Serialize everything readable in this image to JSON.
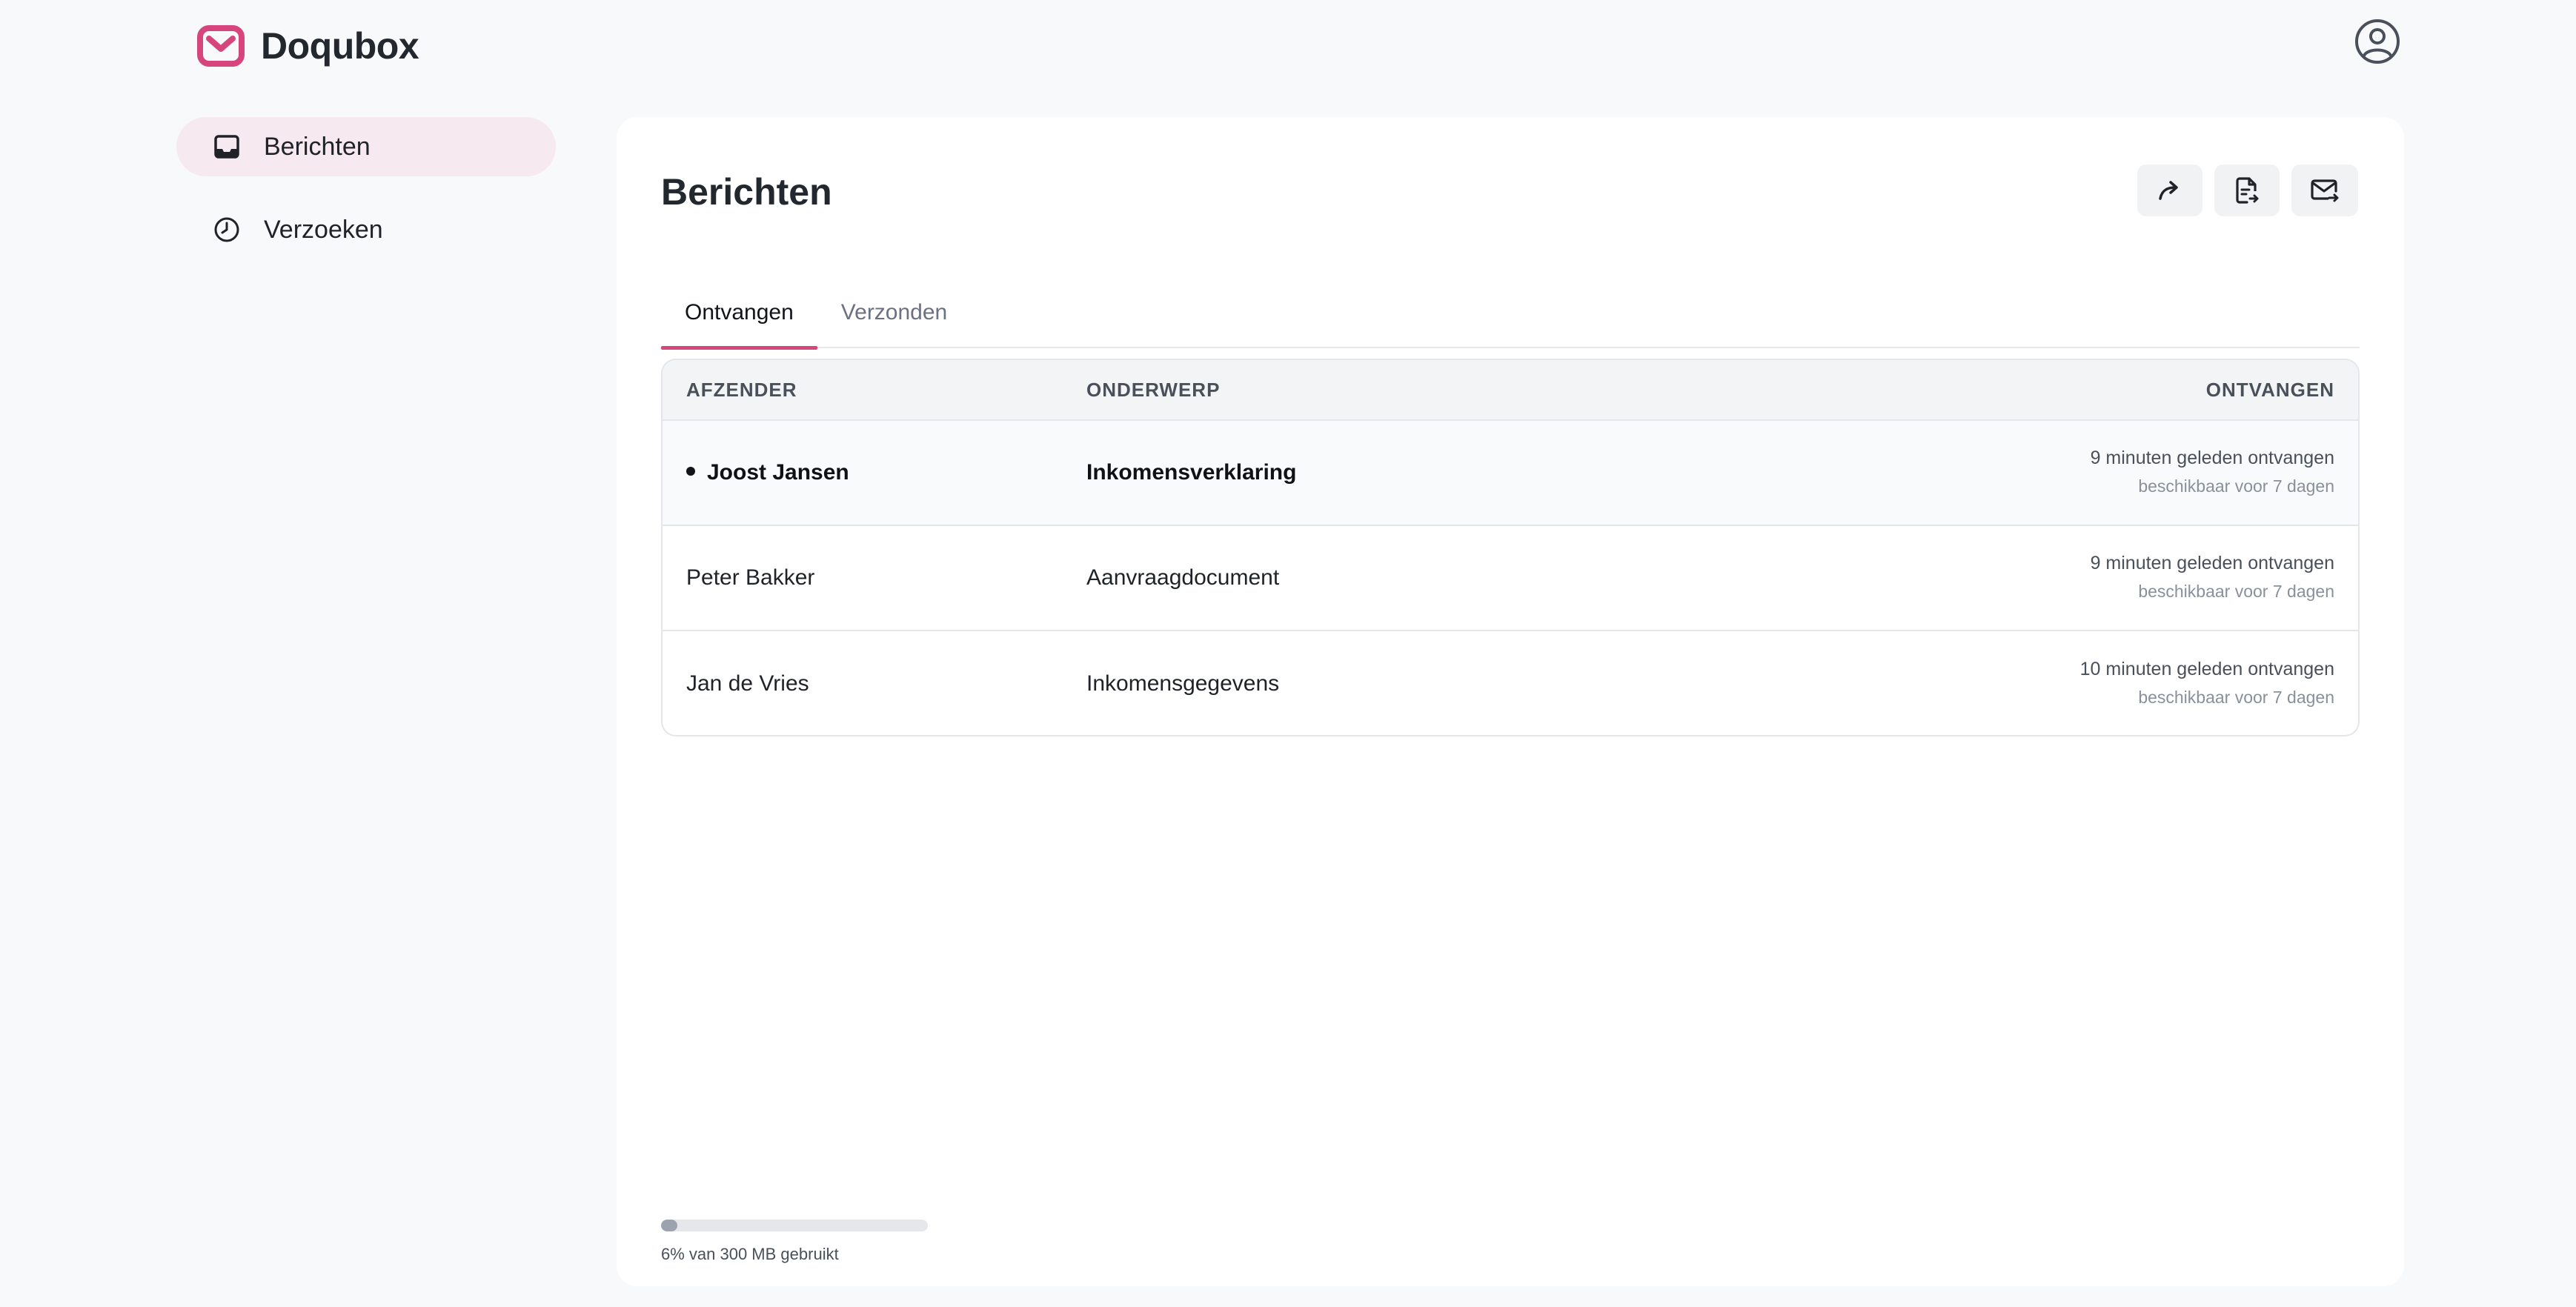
{
  "brand": {
    "name": "Doqubox",
    "accent_color": "#d6457c",
    "logo_icon": "envelope-logo-icon"
  },
  "header": {
    "account_icon": "user-circle-icon"
  },
  "sidebar": {
    "items": [
      {
        "label": "Berichten",
        "icon": "inbox-icon",
        "active": true
      },
      {
        "label": "Verzoeken",
        "icon": "clock-icon",
        "active": false
      }
    ]
  },
  "main": {
    "title": "Berichten",
    "actions": [
      {
        "icon": "forward-arrow-icon"
      },
      {
        "icon": "document-arrow-icon"
      },
      {
        "icon": "mail-arrow-icon"
      }
    ],
    "tabs": [
      {
        "label": "Ontvangen",
        "active": true
      },
      {
        "label": "Verzonden",
        "active": false
      }
    ],
    "table": {
      "columns": [
        "AFZENDER",
        "ONDERWERP",
        "ONTVANGEN"
      ],
      "rows": [
        {
          "sender": "Joost Jansen",
          "subject": "Inkomensverklaring",
          "received": "9 minuten geleden ontvangen",
          "availability": "beschikbaar voor 7 dagen",
          "unread": true
        },
        {
          "sender": "Peter Bakker",
          "subject": "Aanvraagdocument",
          "received": "9 minuten geleden ontvangen",
          "availability": "beschikbaar voor 7 dagen",
          "unread": false
        },
        {
          "sender": "Jan de Vries",
          "subject": "Inkomensgegevens",
          "received": "10 minuten geleden ontvangen",
          "availability": "beschikbaar voor 7 dagen",
          "unread": false
        }
      ]
    },
    "storage": {
      "text": "6% van 300 MB gebruikt",
      "percent_used": 6
    }
  }
}
